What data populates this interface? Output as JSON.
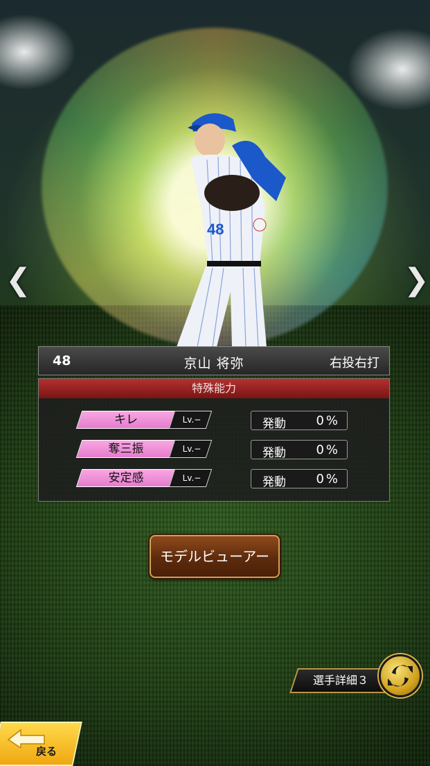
{
  "player": {
    "number": "48",
    "name": "京山 将弥",
    "throw_bat": "右投右打",
    "jersey_number": "48"
  },
  "abilities_panel": {
    "title": "特殊能力",
    "rows": [
      {
        "name": "キレ",
        "level": "Lv.−",
        "activate_label": "発動",
        "rate": "0%"
      },
      {
        "name": "奪三振",
        "level": "Lv.−",
        "activate_label": "発動",
        "rate": "0%"
      },
      {
        "name": "安定感",
        "level": "Lv.−",
        "activate_label": "発動",
        "rate": "0%"
      }
    ]
  },
  "buttons": {
    "model_viewer": "モデルビューアー",
    "player_detail": "選手詳細３",
    "back": "戻る",
    "prev": "❮",
    "next": "❯"
  },
  "icons": {
    "swap": "swap-arrows-icon",
    "back": "back-arrow-icon"
  },
  "colors": {
    "panel_header": "#9a2020",
    "ability_tag": "#f08ad6",
    "button_gold": "#c9a25a"
  }
}
